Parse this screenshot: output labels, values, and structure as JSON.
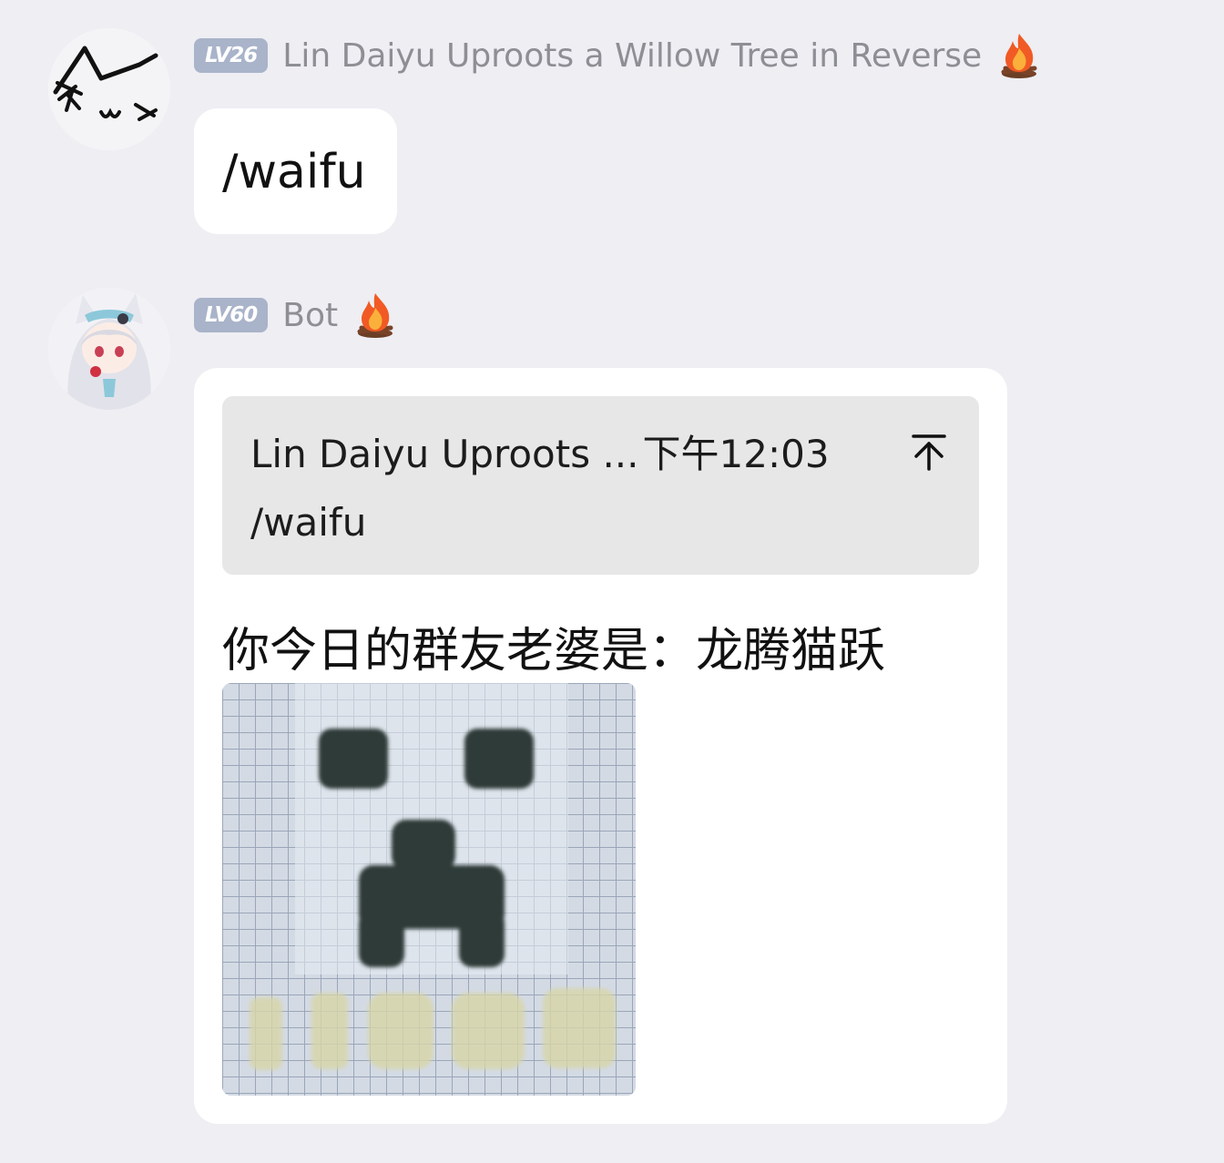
{
  "messages": [
    {
      "avatar": "cat-face-avatar",
      "level": "LV26",
      "name": "Lin Daiyu Uproots a Willow Tree in Reverse",
      "title_icon": "fire-icon",
      "text": "/waifu"
    },
    {
      "avatar": "anime-girl-avatar",
      "level": "LV60",
      "name": "Bot",
      "title_icon": "fire-icon",
      "quote": {
        "author": "Lin Daiyu Uproots ...",
        "time": "下午12:03",
        "text": "/waifu",
        "jump_icon": "jump-to-original-icon"
      },
      "text": "你今日的群友老婆是：龙腾猫跃",
      "image": "creeper-bead-photo"
    }
  ],
  "colors": {
    "background": "#EEEEF3",
    "bubble": "#FFFFFF",
    "badge": "#A9B3C9",
    "name": "#8E8E95",
    "quote_bg": "#E7E7E8"
  }
}
